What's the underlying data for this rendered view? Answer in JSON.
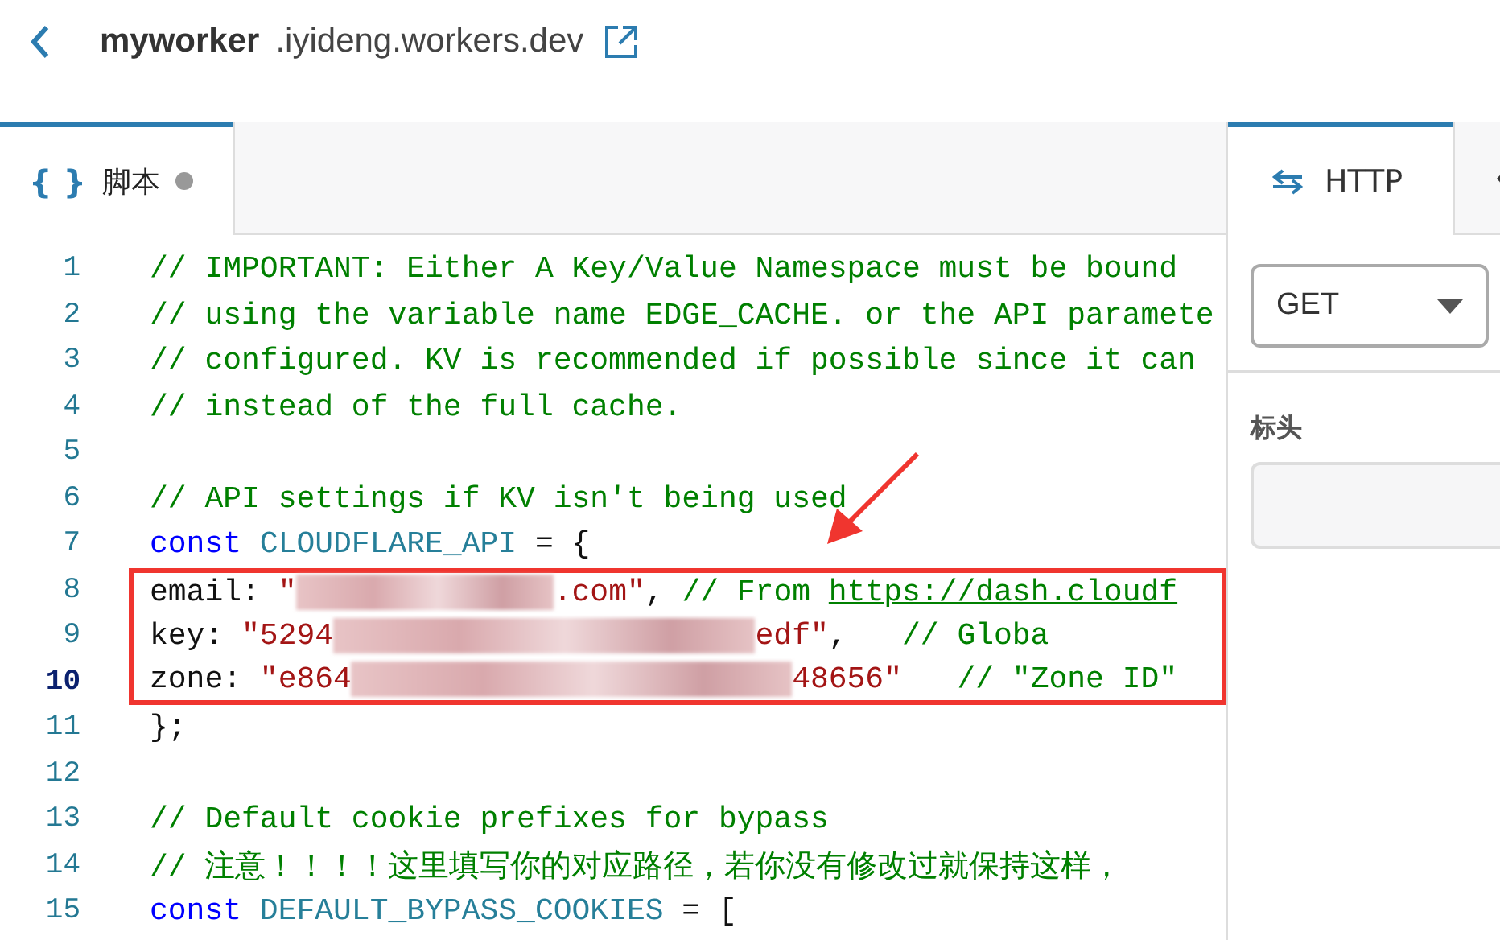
{
  "header": {
    "name": "myworker",
    "domain": ".iyideng.workers.dev"
  },
  "editor_tab": {
    "icon": "{ }",
    "label": "脚本",
    "selected": true,
    "modified": true
  },
  "code_lines": [
    {
      "number": "1",
      "current": false,
      "boxed": false,
      "tokens": [
        {
          "kind": "comment",
          "text": "// IMPORTANT: Either A Key/Value Namespace must be bound"
        }
      ]
    },
    {
      "number": "2",
      "current": false,
      "boxed": false,
      "tokens": [
        {
          "kind": "comment",
          "text": "// using the variable name EDGE_CACHE. or the API paramete"
        }
      ]
    },
    {
      "number": "3",
      "current": false,
      "boxed": false,
      "tokens": [
        {
          "kind": "comment",
          "text": "// configured. KV is recommended if possible since it can"
        }
      ]
    },
    {
      "number": "4",
      "current": false,
      "boxed": false,
      "tokens": [
        {
          "kind": "comment",
          "text": "// instead of the full cache."
        }
      ]
    },
    {
      "number": "5",
      "current": false,
      "boxed": false
    },
    {
      "number": "6",
      "current": false,
      "boxed": false,
      "tokens": [
        {
          "kind": "comment",
          "text": "// API settings if KV isn't being used"
        }
      ]
    },
    {
      "number": "7",
      "current": false,
      "boxed": false,
      "tokens": [
        {
          "kind": "keyword",
          "text": "const"
        },
        {
          "kind": "ident",
          "text": " CLOUDFLARE_API"
        },
        {
          "kind": "plain",
          "text": " = {"
        }
      ]
    },
    {
      "number": "8",
      "current": false,
      "boxed": true,
      "tokens": [
        {
          "kind": "plain",
          "text": "email: "
        },
        {
          "kind": "string",
          "text": "\""
        },
        {
          "kind": "redacted"
        },
        {
          "kind": "string",
          "text": ".com\""
        },
        {
          "kind": "plain",
          "text": ", "
        },
        {
          "kind": "comment",
          "text": "// From "
        },
        {
          "kind": "link",
          "text": "https://dash.cloudf"
        }
      ]
    },
    {
      "number": "9",
      "current": false,
      "boxed": true,
      "tokens": [
        {
          "kind": "plain",
          "text": "key: "
        },
        {
          "kind": "string",
          "text": "\"5294"
        },
        {
          "kind": "redacted"
        },
        {
          "kind": "string",
          "text": "edf\""
        },
        {
          "kind": "plain",
          "text": ",   "
        },
        {
          "kind": "comment",
          "text": "// Globa"
        }
      ]
    },
    {
      "number": "10",
      "current": true,
      "boxed": true,
      "tokens": [
        {
          "kind": "plain",
          "text": "zone: "
        },
        {
          "kind": "string",
          "text": "\"e864"
        },
        {
          "kind": "redacted"
        },
        {
          "kind": "string",
          "text": "48656\""
        },
        {
          "kind": "comment",
          "text": "   // \"Zone ID\""
        }
      ]
    },
    {
      "number": "11",
      "current": false,
      "boxed": false,
      "tokens": [
        {
          "kind": "plain",
          "text": "};"
        }
      ]
    },
    {
      "number": "12",
      "current": false,
      "boxed": false
    },
    {
      "number": "13",
      "current": false,
      "boxed": false,
      "tokens": [
        {
          "kind": "comment",
          "text": "// Default cookie prefixes for bypass"
        }
      ]
    },
    {
      "number": "14",
      "current": false,
      "boxed": false,
      "tokens": [
        {
          "kind": "comment",
          "text": "// 注意！！！！这里填写你的对应路径，若你没有修改过就保持这样，"
        }
      ]
    },
    {
      "number": "15",
      "current": false,
      "boxed": false,
      "tokens": [
        {
          "kind": "keyword",
          "text": "const"
        },
        {
          "kind": "ident",
          "text": " DEFAULT_BYPASS_COOKIES"
        },
        {
          "kind": "plain",
          "text": " = ["
        }
      ]
    }
  ],
  "side_tabs": [
    {
      "label": "HTTP",
      "selected": true
    },
    {
      "selected": false
    }
  ],
  "method": {
    "value": "GET"
  },
  "headers_label": "标头"
}
